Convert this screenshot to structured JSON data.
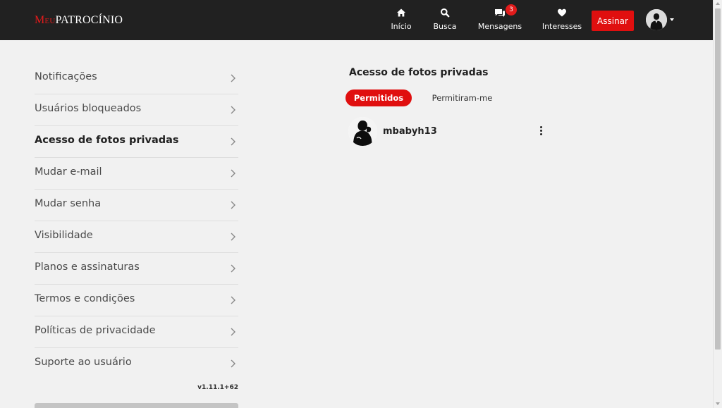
{
  "brand": {
    "part1": "Meu",
    "part2": "Patrocínio",
    "accent_color": "#e21b1b"
  },
  "nav": [
    {
      "icon": "home-icon",
      "label": "Início"
    },
    {
      "icon": "search-icon",
      "label": "Busca"
    },
    {
      "icon": "messages-icon",
      "label": "Mensagens",
      "badge": "3"
    },
    {
      "icon": "heart-icon",
      "label": "Interesses"
    }
  ],
  "header": {
    "subscribe_label": "Assinar",
    "user_menu_icon": "chevron-down-icon"
  },
  "sidebar": {
    "items": [
      {
        "label": "Notificações"
      },
      {
        "label": "Usuários bloqueados"
      },
      {
        "label": "Acesso de fotos privadas",
        "active": true
      },
      {
        "label": "Mudar e-mail"
      },
      {
        "label": "Mudar senha"
      },
      {
        "label": "Visibilidade"
      },
      {
        "label": "Planos e assinaturas"
      },
      {
        "label": "Termos e condições"
      },
      {
        "label": "Políticas de privacidade"
      },
      {
        "label": "Suporte ao usuário"
      }
    ],
    "version": "v1.11.1+62"
  },
  "main": {
    "title": "Acesso de fotos privadas",
    "tabs": [
      {
        "label": "Permitidos",
        "active": true
      },
      {
        "label": "Permitiram-me",
        "active": false
      }
    ],
    "users": [
      {
        "username": "mbabyh13",
        "menu_icon": "more-vertical-icon"
      }
    ]
  },
  "colors": {
    "topbar": "#212121",
    "primary_red": "#e00f0f",
    "background": "#f1f1f1"
  }
}
